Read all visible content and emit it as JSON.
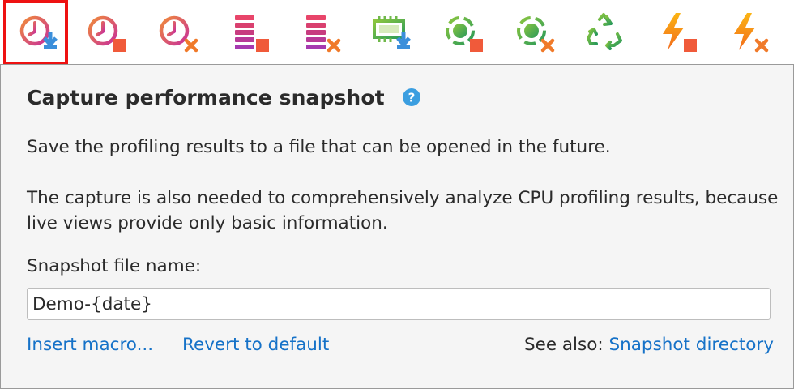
{
  "toolbar": {
    "buttons": [
      {
        "name": "capture-snapshot",
        "icon": "clock-download-icon",
        "selected": true
      },
      {
        "name": "stop-cpu-profiling",
        "icon": "clock-stop-icon"
      },
      {
        "name": "clear-cpu-profiling",
        "icon": "clock-clear-icon"
      },
      {
        "name": "stop-allocation-recording",
        "icon": "stack-stop-icon"
      },
      {
        "name": "clear-allocation-recording",
        "icon": "stack-clear-icon"
      },
      {
        "name": "capture-memory-snapshot",
        "icon": "chip-download-icon"
      },
      {
        "name": "stop-object-counting",
        "icon": "dashed-circle-stop-icon"
      },
      {
        "name": "clear-object-counting",
        "icon": "dashed-circle-clear-icon"
      },
      {
        "name": "force-garbage-collection",
        "icon": "recycle-icon"
      },
      {
        "name": "stop-telemetry",
        "icon": "lightning-stop-icon"
      },
      {
        "name": "clear-telemetry",
        "icon": "lightning-clear-icon"
      }
    ]
  },
  "colors": {
    "selected_border": "#ee1111",
    "stop_square": "#f05a3a",
    "clear_x": "#f07a2a",
    "download_arrow": "#3b8fdb",
    "link": "#1672c8",
    "help": "#3b9ee0"
  },
  "panel": {
    "title": "Capture performance snapshot",
    "paragraph1": "Save the profiling results to a file that can be opened in the future.",
    "paragraph2": "The capture is also needed to comprehensively analyze CPU profiling results, because live views provide only basic information.",
    "filename_label": "Snapshot file name:",
    "filename_value": "Demo-{date}",
    "insert_macro": "Insert macro...",
    "revert_default": "Revert to default",
    "see_also_label": "See also: ",
    "snapshot_directory": "Snapshot directory"
  }
}
